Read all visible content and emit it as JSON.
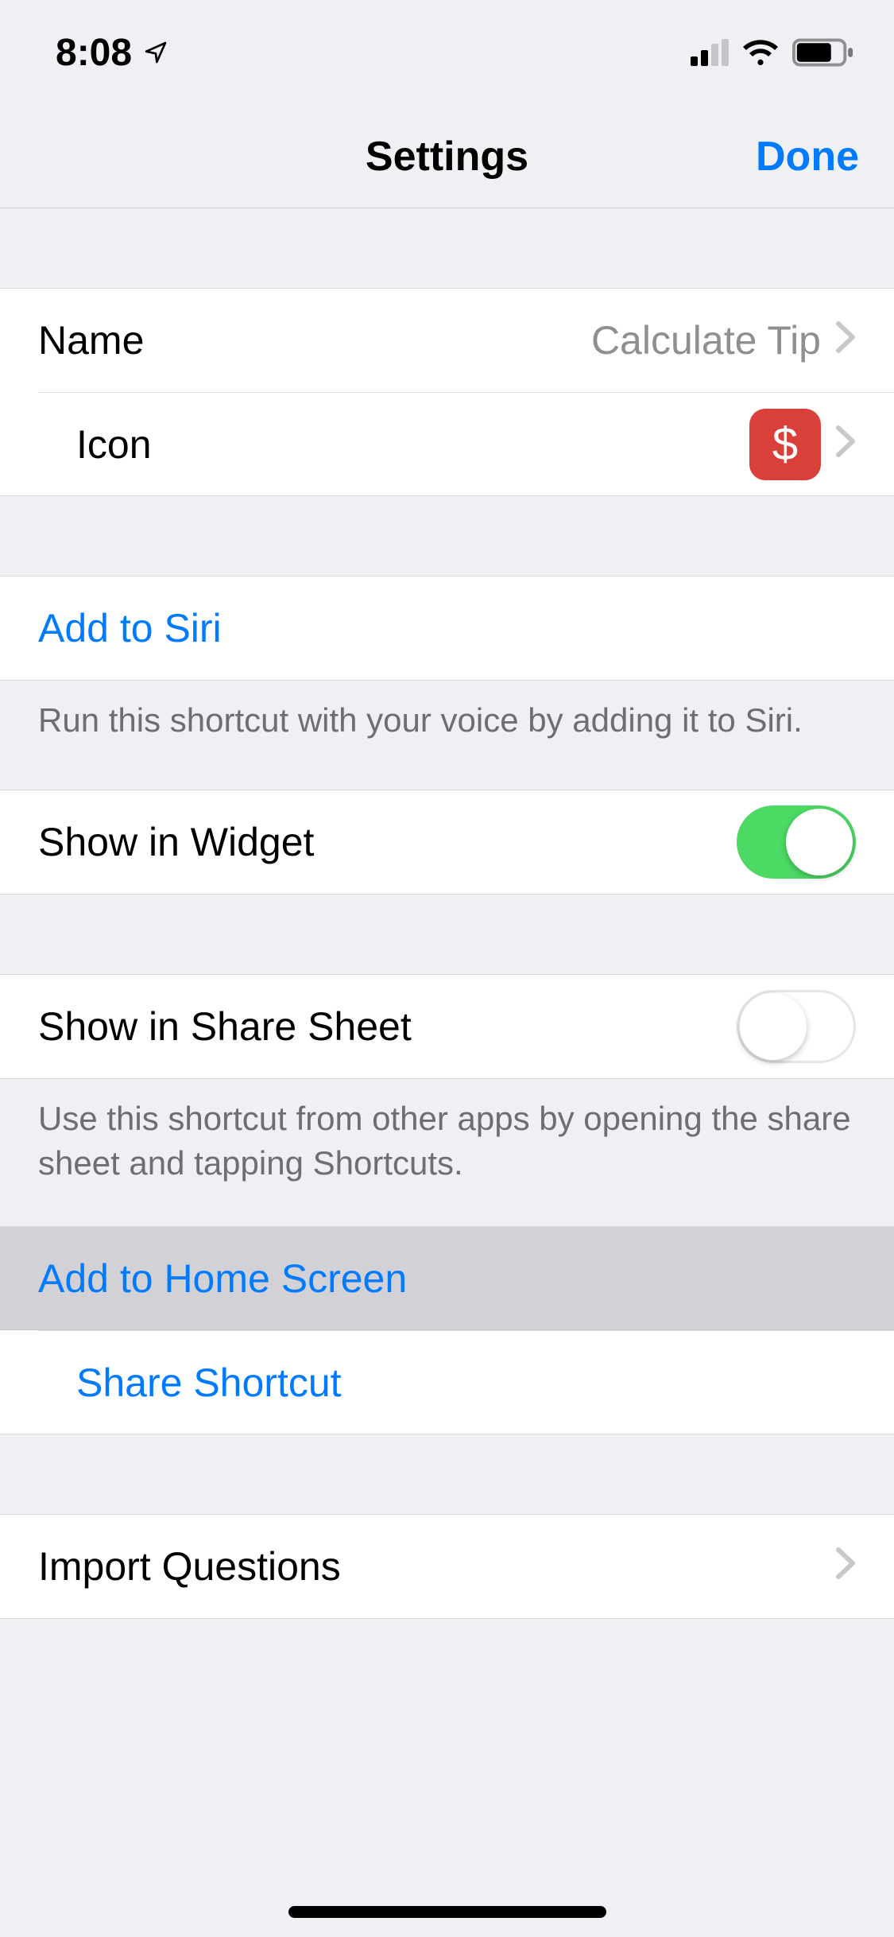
{
  "status": {
    "time": "8:08"
  },
  "nav": {
    "title": "Settings",
    "done": "Done"
  },
  "rows": {
    "name_label": "Name",
    "name_value": "Calculate Tip",
    "icon_label": "Icon",
    "icon_glyph": "$",
    "siri_label": "Add to Siri",
    "siri_footer": "Run this shortcut with your voice by adding it to Siri.",
    "widget_label": "Show in Widget",
    "widget_on": true,
    "sharesheet_label": "Show in Share Sheet",
    "sharesheet_on": false,
    "sharesheet_footer": "Use this shortcut from other apps by opening the share sheet and tapping Shortcuts.",
    "homescreen_label": "Add to Home Screen",
    "share_label": "Share Shortcut",
    "import_label": "Import Questions"
  }
}
